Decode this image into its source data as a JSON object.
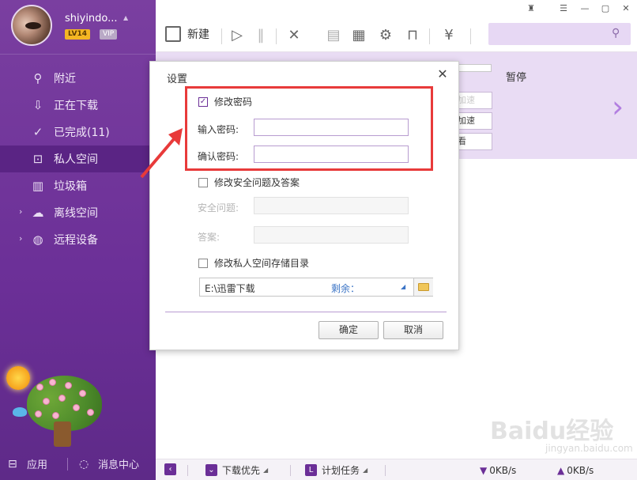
{
  "sidebar": {
    "username": "shiyindo...",
    "level_badge": "LV14",
    "vip_badge": "VIP",
    "items": [
      {
        "label": "附近",
        "icon": "location-icon"
      },
      {
        "label": "正在下载",
        "icon": "download-icon"
      },
      {
        "label": "已完成(11)",
        "icon": "check-circle-icon"
      },
      {
        "label": "私人空间",
        "icon": "lock-icon",
        "active": true
      },
      {
        "label": "垃圾箱",
        "icon": "trash-icon"
      },
      {
        "label": "离线空间",
        "icon": "cloud-icon"
      },
      {
        "label": "远程设备",
        "icon": "globe-icon"
      }
    ],
    "bottom": {
      "apps_label": "应用",
      "messages_label": "消息中心"
    }
  },
  "toolbar": {
    "new_label": "新建"
  },
  "task": {
    "pause_label": "暂停",
    "btn1": "加速",
    "btn2": "加速",
    "btn3": "看"
  },
  "statusbar": {
    "priority_label": "下载优先",
    "schedule_label": "计划任务",
    "down_speed": "0KB/s",
    "up_speed": "0KB/s"
  },
  "dialog": {
    "title": "设置",
    "change_password_label": "修改密码",
    "change_password_checked": true,
    "enter_password_label": "输入密码:",
    "confirm_password_label": "确认密码:",
    "change_security_label": "修改安全问题及答案",
    "security_question_label": "安全问题:",
    "answer_label": "答案:",
    "change_dir_label": "修改私人空间存储目录",
    "dir_path": "E:\\迅雷下载",
    "remaining_label": "剩余：",
    "ok_label": "确定",
    "cancel_label": "取消"
  },
  "watermark": {
    "brand": "Baidu经验",
    "url": "jingyan.baidu.com"
  },
  "colors": {
    "sidebar": "#6b2f97",
    "accent": "#e9dcf4",
    "highlight": "#e83a3a"
  }
}
